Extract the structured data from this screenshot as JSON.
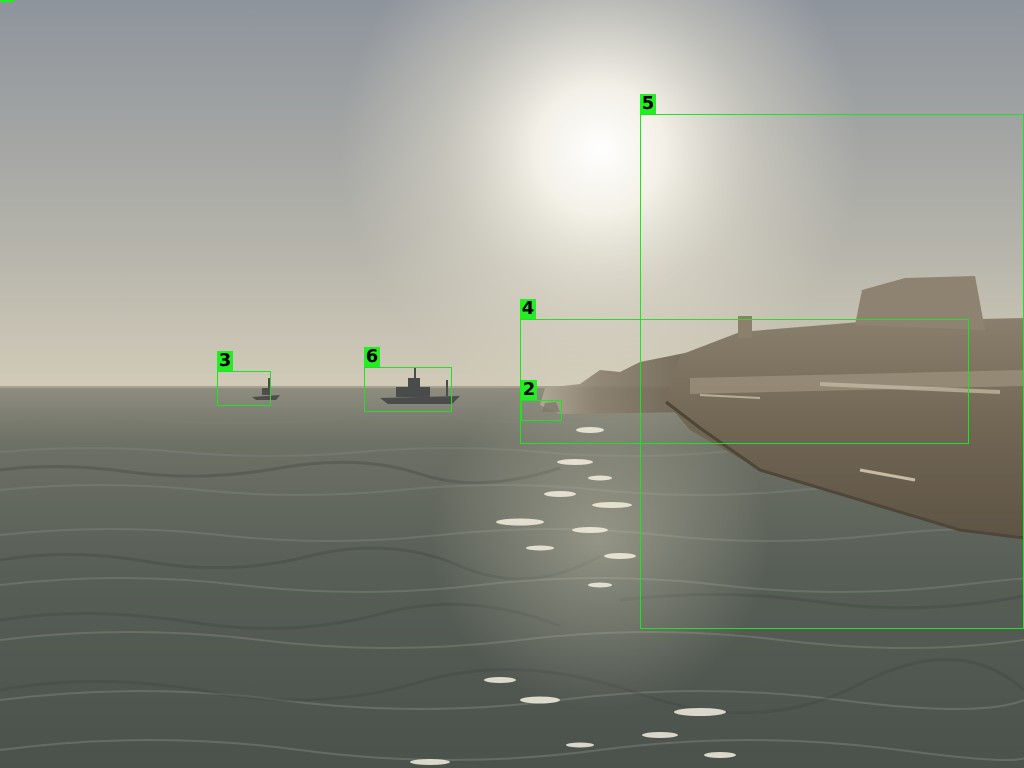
{
  "scene": {
    "colors": {
      "sky_top": "#8f969e",
      "sky_horizon": "#cbc6b8",
      "sun_glow": "#fffdf2",
      "sea_near": "#4f5750",
      "sea_far": "#8c8a7c",
      "ship_hull": "#6a6152",
      "annotation": "#22ee22"
    }
  },
  "annotations": [
    {
      "id": "2",
      "label": "2",
      "object": "boat"
    },
    {
      "id": "3",
      "label": "3",
      "object": "boat"
    },
    {
      "id": "4",
      "label": "4",
      "object": "ship"
    },
    {
      "id": "5",
      "label": "5",
      "object": "ship"
    },
    {
      "id": "6",
      "label": "6",
      "object": "boat"
    }
  ]
}
